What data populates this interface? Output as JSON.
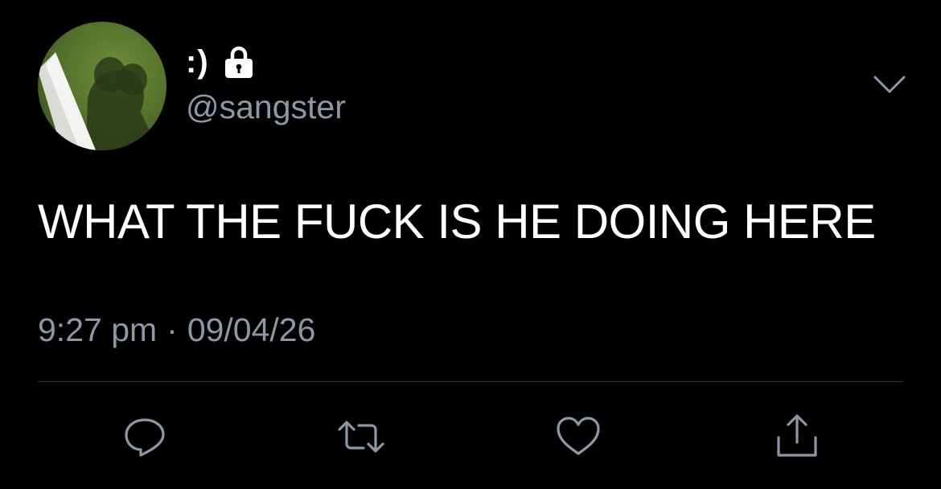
{
  "author": {
    "display_name": ":)",
    "handle": "@sangster",
    "protected": true
  },
  "tweet": {
    "text": "WHAT THE FUCK IS HE DOING HERE",
    "time": "9:27 pm",
    "separator": "·",
    "date": "09/04/26"
  },
  "icons": {
    "lock": "lock-icon",
    "menu": "chevron-down-icon",
    "reply": "reply-icon",
    "retweet": "retweet-icon",
    "like": "heart-icon",
    "share": "share-icon"
  },
  "colors": {
    "background": "#000000",
    "primary_text": "#ffffff",
    "secondary_text": "#8b98a5",
    "divider": "#2f3336",
    "icon": "#8b98a5"
  }
}
